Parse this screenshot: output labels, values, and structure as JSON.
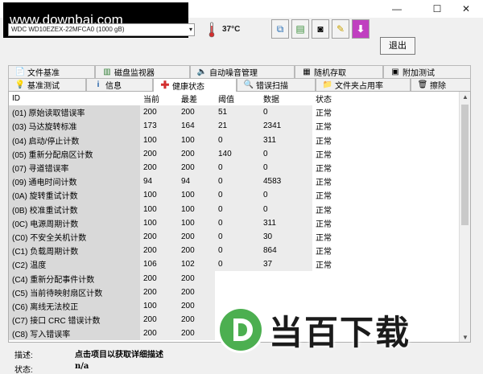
{
  "window": {
    "minimize": "—",
    "maximize": "☐",
    "close": "✕"
  },
  "watermark": "www.downbai.com",
  "toolbar": {
    "drive": "WDC WD10EZEX-22MFCA0 (1000 gB)",
    "temperature": "37°C",
    "exit": "退出"
  },
  "tabs_top": [
    {
      "label": "文件基准",
      "icon": "file-icon"
    },
    {
      "label": "磁盘监视器",
      "icon": "bar-chart-icon"
    },
    {
      "label": "自动噪音管理",
      "icon": "speaker-icon"
    },
    {
      "label": "随机存取",
      "icon": "random-icon"
    },
    {
      "label": "附加测试",
      "icon": "test-icon"
    }
  ],
  "tabs_bottom": [
    {
      "label": "基准测试",
      "icon": "lightbulb-icon"
    },
    {
      "label": "信息",
      "icon": "info-icon"
    },
    {
      "label": "健康状态",
      "icon": "health-cross-icon"
    },
    {
      "label": "错误扫描",
      "icon": "magnifier-icon"
    },
    {
      "label": "文件夹占用率",
      "icon": "folder-icon"
    },
    {
      "label": "擦除",
      "icon": "trash-icon"
    }
  ],
  "table": {
    "headers": [
      "ID",
      "当前",
      "最差",
      "阈值",
      "数据",
      "状态"
    ],
    "rows": [
      [
        "(01) 原始读取错误率",
        "200",
        "200",
        "51",
        "0",
        "正常"
      ],
      [
        "(03) 马达旋转标准",
        "173",
        "164",
        "21",
        "2341",
        "正常"
      ],
      [
        "(04) 启动/停止计数",
        "100",
        "100",
        "0",
        "311",
        "正常"
      ],
      [
        "(05) 重新分配扇区计数",
        "200",
        "200",
        "140",
        "0",
        "正常"
      ],
      [
        "(07) 寻道错误率",
        "200",
        "200",
        "0",
        "0",
        "正常"
      ],
      [
        "(09) 通电时间计数",
        "94",
        "94",
        "0",
        "4583",
        "正常"
      ],
      [
        "(0A) 旋转重试计数",
        "100",
        "100",
        "0",
        "0",
        "正常"
      ],
      [
        "(0B) 校准重试计数",
        "100",
        "100",
        "0",
        "0",
        "正常"
      ],
      [
        "(0C) 电源周期计数",
        "100",
        "100",
        "0",
        "311",
        "正常"
      ],
      [
        "(C0) 不安全关机计数",
        "200",
        "200",
        "0",
        "30",
        "正常"
      ],
      [
        "(C1) 负载周期计数",
        "200",
        "200",
        "0",
        "864",
        "正常"
      ],
      [
        "(C2) 温度",
        "106",
        "102",
        "0",
        "37",
        "正常"
      ],
      [
        "(C4) 重新分配事件计数",
        "200",
        "200",
        "",
        "",
        ""
      ],
      [
        "(C5) 当前待映射扇区计数",
        "200",
        "200",
        "",
        "",
        ""
      ],
      [
        "(C6) 离线无法校正",
        "100",
        "200",
        "",
        "",
        ""
      ],
      [
        "(C7) 接口 CRC 错误计数",
        "200",
        "200",
        "",
        "",
        ""
      ],
      [
        "(C8) 写入错误率",
        "200",
        "200",
        "",
        "",
        ""
      ]
    ]
  },
  "status": {
    "desc_label": "描述:",
    "desc_value": "点击项目以获取详细描述",
    "state_label": "状态:",
    "state_value": "n/a"
  },
  "logo": {
    "text": "当百下载"
  },
  "colors": {
    "accent": "#4caf50",
    "danger": "#d32f2f",
    "temp": "#d32f2f"
  }
}
